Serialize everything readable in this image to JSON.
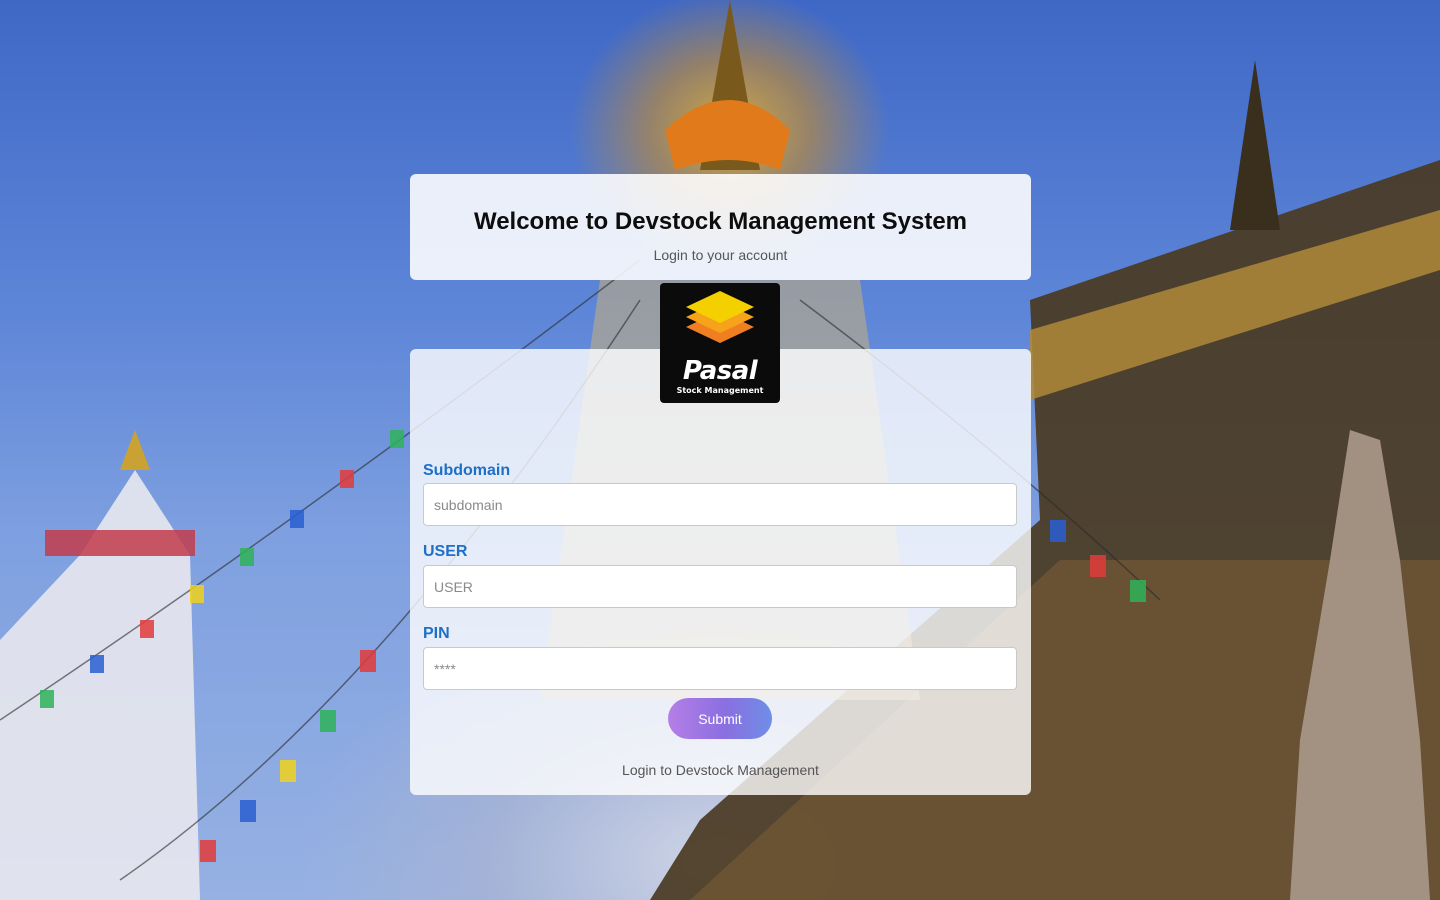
{
  "header": {
    "title": "Welcome to Devstock Management System",
    "subtitle": "Login to your account"
  },
  "logo": {
    "brand": "Pasal",
    "tagline": "Stock Management",
    "icon": "stacked-layers-icon",
    "colors": [
      "#f5d000",
      "#f7a21b",
      "#f07f22"
    ]
  },
  "form": {
    "subdomain": {
      "label": "Subdomain",
      "placeholder": "subdomain",
      "value": ""
    },
    "user": {
      "label": "USER",
      "placeholder": "USER",
      "value": ""
    },
    "pin": {
      "label": "PIN",
      "placeholder": "****",
      "value": ""
    },
    "submit_label": "Submit"
  },
  "footer": {
    "text": "Login to Devstock Management"
  },
  "colors": {
    "label_blue": "#1e6fc8",
    "button_gradient_start": "#b57ee6",
    "button_gradient_end": "#6f8ee6"
  }
}
